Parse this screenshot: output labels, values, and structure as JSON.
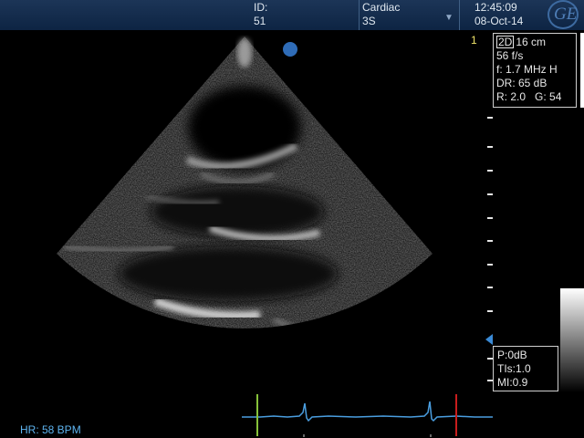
{
  "header": {
    "id_label": "ID:",
    "id_value": "51",
    "preset": "Cardiac",
    "probe": "3S",
    "dropdown_icon": "triangle-down",
    "time": "12:45:09",
    "date": "08-Oct-14",
    "logo": "GE"
  },
  "image": {
    "frame_number": "1"
  },
  "params": {
    "mode": "2D",
    "depth": "16 cm",
    "frame_rate": "56 f/s",
    "frequency": "f: 1.7 MHz H",
    "dynamic_range": "DR: 65 dB",
    "reject": "R: 2.0",
    "gain": "G: 54"
  },
  "safety": {
    "power": "P:0dB",
    "tis": "TIs:1.0",
    "mi": "MI:0.9"
  },
  "ecg": {
    "heart_rate": "HR: 58 BPM"
  },
  "colors": {
    "header_bg": "#0d2443",
    "ecg_trace": "#4a9ee0",
    "marker_green": "#86c23a",
    "marker_red": "#c81d1d",
    "frame_number": "#f0e46a"
  }
}
